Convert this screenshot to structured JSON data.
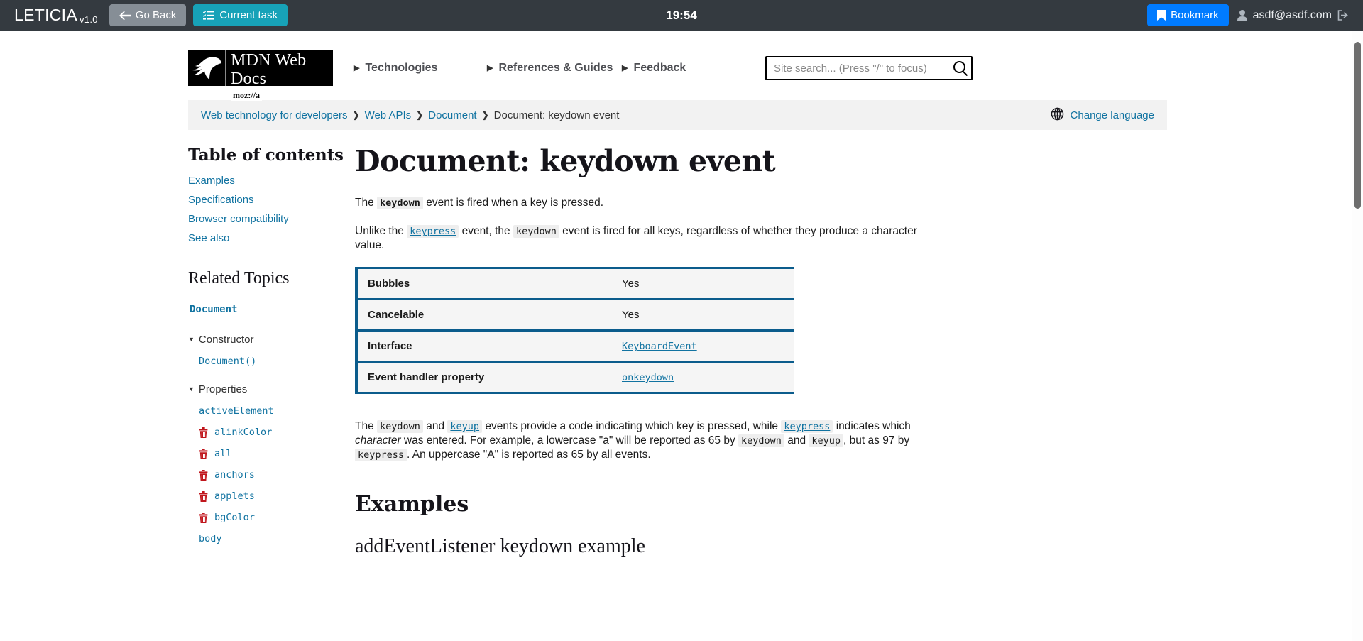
{
  "agent_bar": {
    "brand": "LETICIA",
    "version": "v1.0",
    "go_back_label": "Go Back",
    "current_task_label": "Current task",
    "clock": "19:54",
    "bookmark_label": "Bookmark",
    "user_email": "asdf@asdf.com",
    "icons": {
      "back": "arrow-left-icon",
      "task": "task-list-icon",
      "bookmark": "bookmark-icon",
      "user": "user-icon",
      "logout": "sign-out-icon"
    },
    "colors": {
      "bar_bg": "#343a40",
      "secondary": "#868e96",
      "info": "#17a2b8",
      "primary": "#007bff"
    }
  },
  "site_header": {
    "logo_title": "MDN Web Docs",
    "logo_sub": "moz://a",
    "nav": [
      {
        "label": "Technologies"
      },
      {
        "label": "References & Guides"
      },
      {
        "label": "Feedback"
      }
    ],
    "search": {
      "placeholder": "Site search... (Press \"/\" to focus)",
      "value": ""
    }
  },
  "breadcrumb": {
    "items": [
      {
        "label": "Web technology for developers",
        "current": false
      },
      {
        "label": "Web APIs",
        "current": false
      },
      {
        "label": "Document",
        "current": false
      },
      {
        "label": "Document: keydown event",
        "current": true
      }
    ],
    "separator": "❯",
    "change_language": "Change language"
  },
  "sidebar": {
    "toc_title": "Table of contents",
    "toc_items": [
      {
        "label": "Examples"
      },
      {
        "label": "Specifications"
      },
      {
        "label": "Browser compatibility"
      },
      {
        "label": "See also"
      }
    ],
    "related_title": "Related Topics",
    "related_root": "Document",
    "groups": [
      {
        "label": "Constructor",
        "expanded": true,
        "items": [
          {
            "label": "Document()",
            "deprecated": false
          }
        ]
      },
      {
        "label": "Properties",
        "expanded": true,
        "items": [
          {
            "label": "activeElement",
            "deprecated": false
          },
          {
            "label": "alinkColor",
            "deprecated": true
          },
          {
            "label": "all",
            "deprecated": true
          },
          {
            "label": "anchors",
            "deprecated": true
          },
          {
            "label": "applets",
            "deprecated": true
          },
          {
            "label": "bgColor",
            "deprecated": true
          },
          {
            "label": "body",
            "deprecated": false
          }
        ]
      }
    ]
  },
  "article": {
    "title": "Document: keydown event",
    "p1": {
      "before": "The ",
      "code": "keydown",
      "after": " event is fired when a key is pressed."
    },
    "p2": {
      "t1": "Unlike the ",
      "link": "keypress",
      "t2": " event, the ",
      "code": "keydown",
      "t3": " event is fired for all keys, regardless of whether they produce a character value."
    },
    "table": {
      "rows": [
        {
          "key": "Bubbles",
          "value": "Yes",
          "is_link": false
        },
        {
          "key": "Cancelable",
          "value": "Yes",
          "is_link": false
        },
        {
          "key": "Interface",
          "value": "KeyboardEvent",
          "is_link": true
        },
        {
          "key": "Event handler property",
          "value": "onkeydown",
          "is_link": true
        }
      ],
      "border_color": "#0b5c8c",
      "cell_bg": "#f5f5f5"
    },
    "p3": {
      "t1": "The ",
      "c1": "keydown",
      "t2": " and ",
      "l1": "keyup",
      "t3": " events provide a code indicating which key is pressed, while ",
      "l2": "keypress",
      "t4": " indicates which ",
      "em1": "character",
      "t5": " was entered. For example, a lowercase \"a\" will be reported as 65 by ",
      "c2": "keydown",
      "t6": " and ",
      "c3": "keyup",
      "t7": ", but as 97 by ",
      "c4": "keypress",
      "t8": ". An uppercase \"A\" is reported as 65 by all events."
    },
    "h2_examples": "Examples",
    "h3_example": "addEventListener keydown example"
  }
}
